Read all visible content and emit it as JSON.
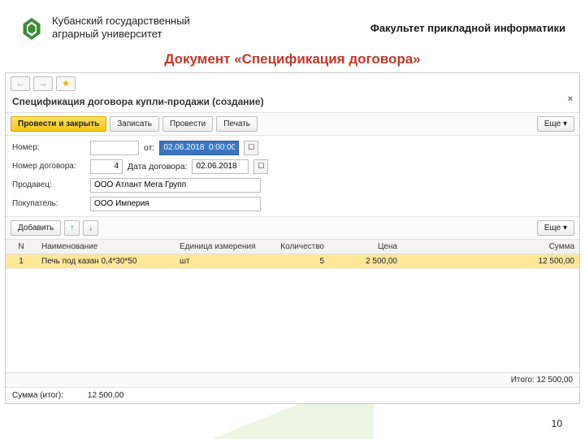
{
  "header": {
    "university_line1": "Кубанский государственный",
    "university_line2": "аграрный университет",
    "faculty": "Факультет прикладной информатики"
  },
  "doc_title": "Документ «Спецификация договора»",
  "app": {
    "nav": {
      "back": "←",
      "fwd": "→",
      "star": "★"
    },
    "title": "Спецификация договора купли-продажи (создание)",
    "close": "×",
    "cmd": {
      "post_close": "Провести и закрыть",
      "write": "Записать",
      "post": "Провести",
      "print": "Печать",
      "more": "Еще ▾"
    },
    "form": {
      "number_lbl": "Номер:",
      "number_val": "",
      "from_lbl": "от:",
      "from_val": "02.06.2018  0:00:00",
      "contract_num_lbl": "Номер договора:",
      "contract_num_val": "4",
      "contract_date_lbl": "Дата договора:",
      "contract_date_val": "02.06.2018",
      "seller_lbl": "Продавец:",
      "seller_val": "ООО Атлант Мега Групп",
      "buyer_lbl": "Покупатель:",
      "buyer_val": "ООО Империя"
    },
    "subbar": {
      "add": "Добавить",
      "up": "↑",
      "down": "↓",
      "more": "Еще ▾"
    },
    "table": {
      "cols": {
        "n": "N",
        "name": "Наименование",
        "unit": "Единица измерения",
        "qty": "Количество",
        "price": "Цена",
        "sum": "Сумма"
      },
      "rows": [
        {
          "n": "1",
          "name": "Печь под казан 0,4*30*50",
          "unit": "шт",
          "qty": "5",
          "price": "2 500,00",
          "sum": "12 500,00"
        }
      ]
    },
    "footer": {
      "total_lbl": "Итого:",
      "total_val": "12 500,00",
      "sum_total_lbl": "Сумма (итог):",
      "sum_total_val": "12 500,00"
    }
  },
  "page_number": "10"
}
